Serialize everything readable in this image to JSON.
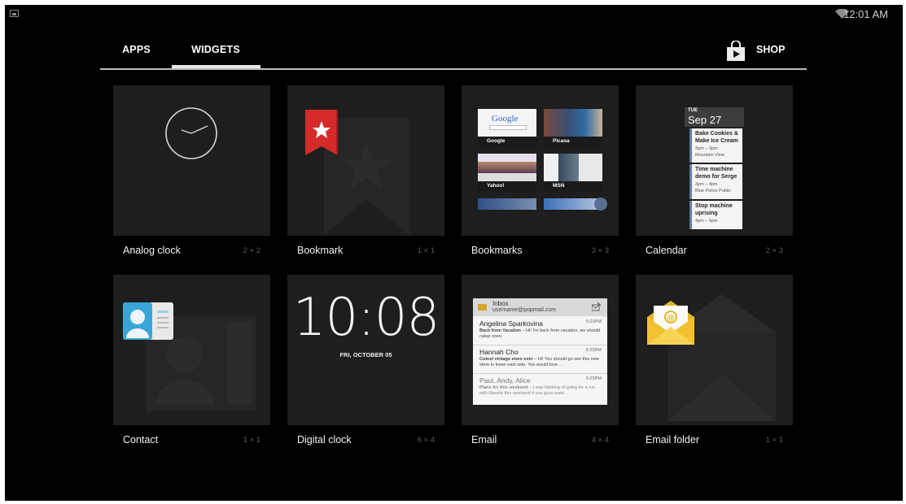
{
  "status_bar": {
    "time": "12:01 AM",
    "left_icon": "screenshot-notification-icon",
    "wifi_icon": "wifi-icon"
  },
  "tabs": [
    {
      "label": "APPS",
      "selected": false
    },
    {
      "label": "WIDGETS",
      "selected": true
    }
  ],
  "shop": {
    "label": "SHOP",
    "icon": "play-store-bag-icon"
  },
  "widgets": [
    {
      "name": "Analog clock",
      "size": "2 × 2"
    },
    {
      "name": "Bookmark",
      "size": "1 × 1"
    },
    {
      "name": "Bookmarks",
      "size": "3 × 3"
    },
    {
      "name": "Calendar",
      "size": "2 × 3"
    },
    {
      "name": "Contact",
      "size": "1 × 1"
    },
    {
      "name": "Digital clock",
      "size": "6 × 4"
    },
    {
      "name": "Email",
      "size": "4 × 4"
    },
    {
      "name": "Email folder",
      "size": "1 × 1"
    }
  ],
  "bookmarks_preview": {
    "sites": [
      "Google",
      "Picasa",
      "Yahoo!",
      "MSN"
    ],
    "google_logo": "Google"
  },
  "calendar_preview": {
    "day_of_week": "TUE",
    "date": "Sep 27",
    "events": [
      {
        "title": "Bake Cookies & Make Ice Cream",
        "time": "2pm – 3pm",
        "location": "Mountain View"
      },
      {
        "title": "Time machine demo for Serge",
        "time": "3pm – 4pm",
        "location": "Blue Police Public"
      },
      {
        "title": "Stop machine uprising",
        "time": "4pm – 5pm",
        "location": ""
      }
    ]
  },
  "digital_clock_preview": {
    "time": "10:08",
    "date": "FRI, OCTOBER 05"
  },
  "email_preview": {
    "folder": "Inbox",
    "account": "username@popmail.com",
    "messages": [
      {
        "from": "Angelina Sparkovina",
        "time": "5:23PM",
        "subject": "Back from Vacation",
        "snippet": " – Hi! I'm back from vacation, we should catup soon.",
        "read": false
      },
      {
        "from": "Hannah Cho",
        "time": "5:23PM",
        "subject": "Cutest vintage store ever",
        "snippet": " – Hi! You should go see this new store in lower east side. You would love...",
        "read": false
      },
      {
        "from": "Paul, Andy, Alice",
        "time": "5:23PM",
        "subject": "Plans for this weekend",
        "snippet": " – I was thinking of going for a run with Maoshi this weekend if you guys want...",
        "read": true
      }
    ]
  },
  "colors": {
    "background": "#000000",
    "tile": "#1e1e1e",
    "bookmark_ribbon": "#d42a2a",
    "contact_card": "#3aa6d8",
    "email_envelope": "#f2c230"
  }
}
